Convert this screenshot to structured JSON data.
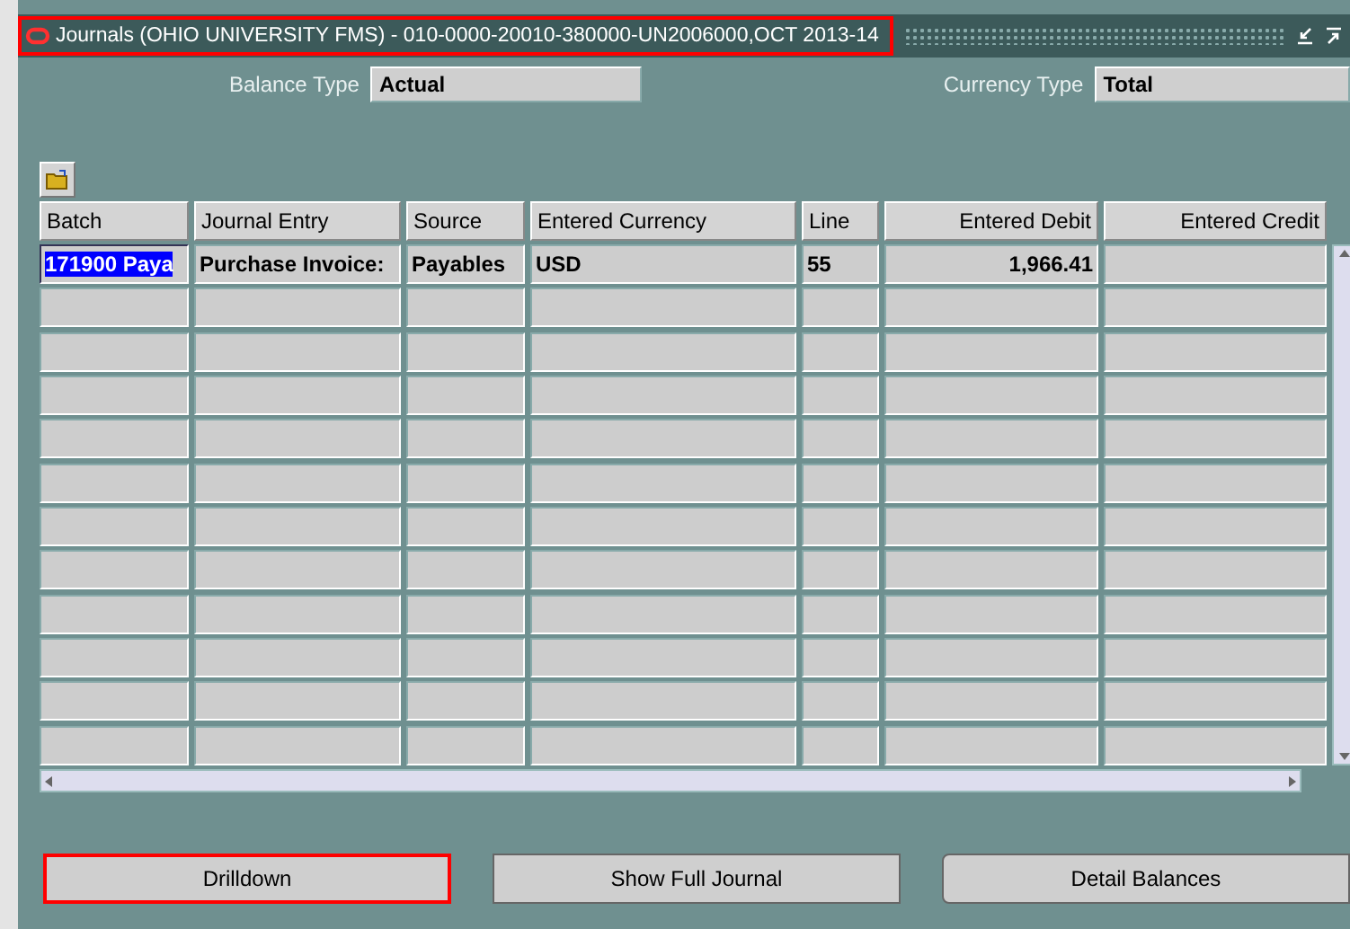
{
  "window": {
    "title": "Journals (OHIO UNIVERSITY FMS) - 010-0000-20010-380000-UN2006000,OCT 2013-14",
    "highlighted": true
  },
  "fields": [
    {
      "label": "Balance Type",
      "value": "Actual"
    },
    {
      "label": "Currency Type",
      "value": "Total"
    }
  ],
  "table": {
    "columns": [
      {
        "label": "Batch",
        "kind": "text"
      },
      {
        "label": "Journal Entry",
        "kind": "text"
      },
      {
        "label": "Source",
        "kind": "text"
      },
      {
        "label": "Entered Currency",
        "kind": "text"
      },
      {
        "label": "Line",
        "kind": "text"
      },
      {
        "label": "Entered Debit",
        "kind": "amount"
      },
      {
        "label": "Entered Credit",
        "kind": "amount"
      }
    ],
    "rows": [
      {
        "cells": [
          "171900 Paya",
          "Purchase Invoice:",
          "Payables",
          "USD",
          "55",
          "1,966.41",
          ""
        ],
        "selected": true
      },
      {
        "cells": [
          "",
          "",
          "",
          "",
          "",
          "",
          ""
        ],
        "selected": false
      },
      {
        "cells": [
          "",
          "",
          "",
          "",
          "",
          "",
          ""
        ],
        "selected": false
      },
      {
        "cells": [
          "",
          "",
          "",
          "",
          "",
          "",
          ""
        ],
        "selected": false
      },
      {
        "cells": [
          "",
          "",
          "",
          "",
          "",
          "",
          ""
        ],
        "selected": false
      },
      {
        "cells": [
          "",
          "",
          "",
          "",
          "",
          "",
          ""
        ],
        "selected": false
      },
      {
        "cells": [
          "",
          "",
          "",
          "",
          "",
          "",
          ""
        ],
        "selected": false
      },
      {
        "cells": [
          "",
          "",
          "",
          "",
          "",
          "",
          ""
        ],
        "selected": false
      },
      {
        "cells": [
          "",
          "",
          "",
          "",
          "",
          "",
          ""
        ],
        "selected": false
      },
      {
        "cells": [
          "",
          "",
          "",
          "",
          "",
          "",
          ""
        ],
        "selected": false
      },
      {
        "cells": [
          "",
          "",
          "",
          "",
          "",
          "",
          ""
        ],
        "selected": false
      },
      {
        "cells": [
          "",
          "",
          "",
          "",
          "",
          "",
          ""
        ],
        "selected": false
      }
    ]
  },
  "buttons": [
    {
      "label": "Drilldown",
      "highlighted": true
    },
    {
      "label": "Show Full Journal",
      "highlighted": false
    },
    {
      "label": "Detail Balances",
      "highlighted": false
    }
  ]
}
